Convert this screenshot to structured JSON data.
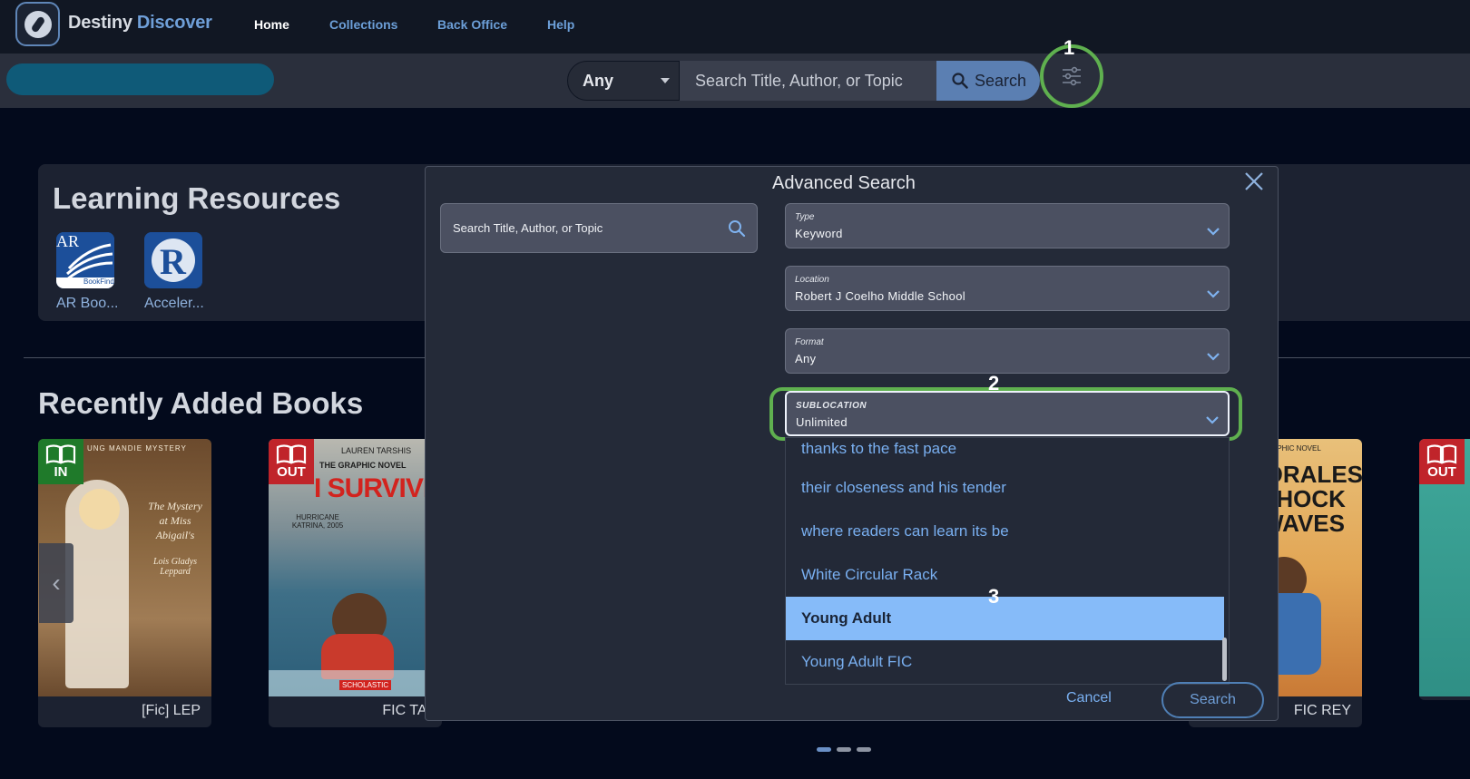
{
  "brand": {
    "name_part1": "Destiny",
    "name_part2": "Discover"
  },
  "nav": {
    "items": [
      {
        "label": "Home"
      },
      {
        "label": "Collections"
      },
      {
        "label": "Back Office"
      },
      {
        "label": "Help"
      }
    ]
  },
  "search_bar": {
    "type_value": "Any",
    "placeholder": "Search Title, Author, or Topic",
    "button_label": "Search"
  },
  "callouts": {
    "one": "1",
    "two": "2",
    "three": "3"
  },
  "learning_resources": {
    "title": "Learning Resources",
    "tiles": [
      {
        "label": "AR Boo...",
        "tile_text": "AR",
        "tile_subtext": "BookFinde"
      },
      {
        "label": "Acceler...",
        "tile_text": "R"
      }
    ]
  },
  "recently_added": {
    "title": "Recently Added Books",
    "books": [
      {
        "status": "IN",
        "call_number": "[Fic] LEP",
        "cover_title": "The Mystery at Miss Abigail's",
        "cover_author": "Lois Gladys Leppard",
        "cover_series": "UNG MANDIE MYSTERY"
      },
      {
        "status": "OUT",
        "call_number": "FIC TAI",
        "cover_title": "I SURVIVED",
        "cover_kicker": "THE GRAPHIC NOVEL",
        "cover_author": "LAUREN TARSHIS",
        "cover_subtitle": "HURRICANE KATRINA, 2005",
        "cover_publisher": "SCHOLASTIC"
      },
      {
        "status": "",
        "call_number": "FIC REY",
        "cover_title": "MORALES SHOCK WAVES",
        "cover_kicker": "GRAPHIC NOVEL"
      },
      {
        "status": "OUT",
        "call_number": ""
      }
    ]
  },
  "modal": {
    "title": "Advanced Search",
    "search_placeholder": "Search Title, Author, or Topic",
    "fields": {
      "type": {
        "label": "Type",
        "value": "Keyword"
      },
      "location": {
        "label": "Location",
        "value": "Robert J Coelho Middle School"
      },
      "format": {
        "label": "Format",
        "value": "Any"
      },
      "sublocation": {
        "label": "SUBLOCATION",
        "value": "Unlimited"
      }
    },
    "options": [
      {
        "label": "thanks to the fast pace",
        "selected": false
      },
      {
        "label": "their closeness and his tender",
        "selected": false
      },
      {
        "label": "where readers can learn its be",
        "selected": false
      },
      {
        "label": "White Circular Rack",
        "selected": false
      },
      {
        "label": "Young Adult",
        "selected": true
      },
      {
        "label": "Young Adult FIC",
        "selected": false
      }
    ],
    "cancel_label": "Cancel",
    "search_label": "Search"
  },
  "colors": {
    "page_bg": "#030a1c",
    "accent_blue": "#6f9fd8",
    "highlight_green": "#5fb04f",
    "badge_in": "#1f7a2a",
    "badge_out": "#c0242a",
    "selected_option": "#86bbf9"
  }
}
